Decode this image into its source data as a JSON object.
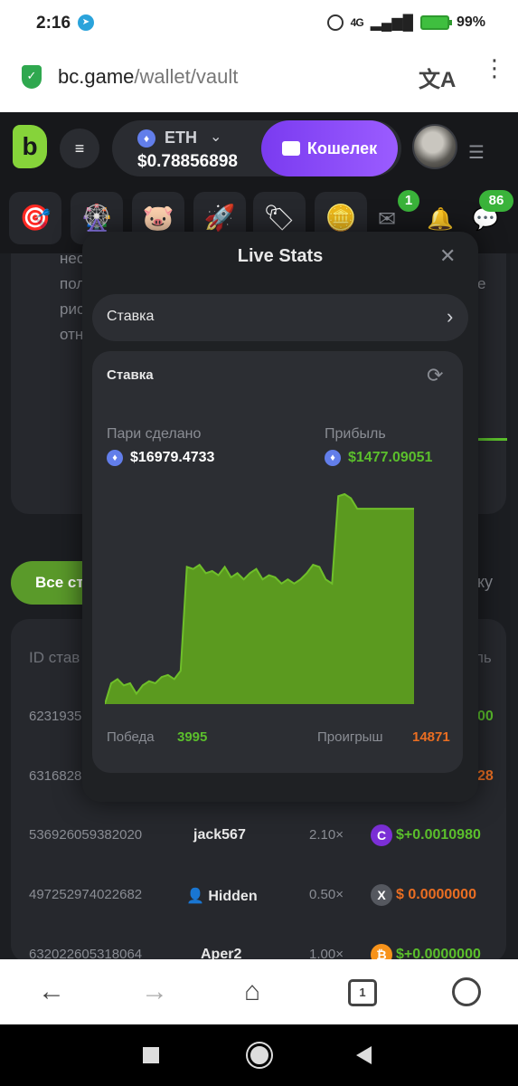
{
  "status_bar": {
    "time": "2:16",
    "network": "4G",
    "battery": "99%"
  },
  "browser": {
    "url_host": "bc.game",
    "url_path": "/wallet/vault",
    "tab_count": "1"
  },
  "header": {
    "logo": "b",
    "currency": "ETH",
    "balance": "$0.78856898",
    "wallet_button": "Кошелек"
  },
  "icon_strip": {
    "mail_badge": "1",
    "chat_badge": "86"
  },
  "background": {
    "text_lines": [
      "нес",
      "пол",
      "рис",
      "отн"
    ],
    "text_right": "е",
    "tab_label": "Все ст",
    "tab_right": "онку",
    "table_header_id": "ID став",
    "table_header_right": "ль",
    "partial_rows": [
      {
        "id": "6231935",
        "amount": "00",
        "amount_class": "green"
      },
      {
        "id": "6316828",
        "amount": "28",
        "amount_class": "orange"
      }
    ],
    "rows": [
      {
        "id": "536926059382020",
        "user": "jack567",
        "multiplier": "2.10×",
        "coin": "C",
        "coin_color": "#7b2fd6",
        "amount": "$+0.0010980",
        "amount_class": "green"
      },
      {
        "id": "497252974022682",
        "user": "Hidden",
        "multiplier": "0.50×",
        "coin": "X",
        "coin_color": "#55585f",
        "amount": "$  0.0000000",
        "amount_class": "orange"
      },
      {
        "id": "632022605318064",
        "user": "Aper2",
        "multiplier": "1.00×",
        "coin": "₿",
        "coin_color": "#f7931a",
        "amount": "$+0.0000000",
        "amount_class": "green"
      }
    ]
  },
  "modal": {
    "title": "Live Stats",
    "select_label": "Ставка",
    "card_title": "Ставка",
    "wagered_label": "Пари сделано",
    "wagered_value": "$16979.4733",
    "profit_label": "Прибыль",
    "profit_value": "$1477.09051",
    "wins_label": "Победа",
    "wins_value": "3995",
    "losses_label": "Проигрыш",
    "losses_value": "14871"
  },
  "chart_data": {
    "type": "area",
    "title": "",
    "xlabel": "",
    "ylabel": "",
    "color": "#5b9a1f",
    "series": [
      {
        "values": [
          0,
          10,
          12,
          9,
          10,
          5,
          9,
          11,
          10,
          13,
          14,
          12,
          16,
          66,
          65,
          67,
          63,
          64,
          62,
          66,
          61,
          63,
          60,
          63,
          65,
          60,
          62,
          61,
          58,
          60,
          58,
          60,
          63,
          67,
          66,
          60,
          58,
          100,
          101,
          99,
          94,
          94,
          94,
          94,
          94,
          94,
          94,
          94,
          94,
          94
        ]
      }
    ]
  }
}
